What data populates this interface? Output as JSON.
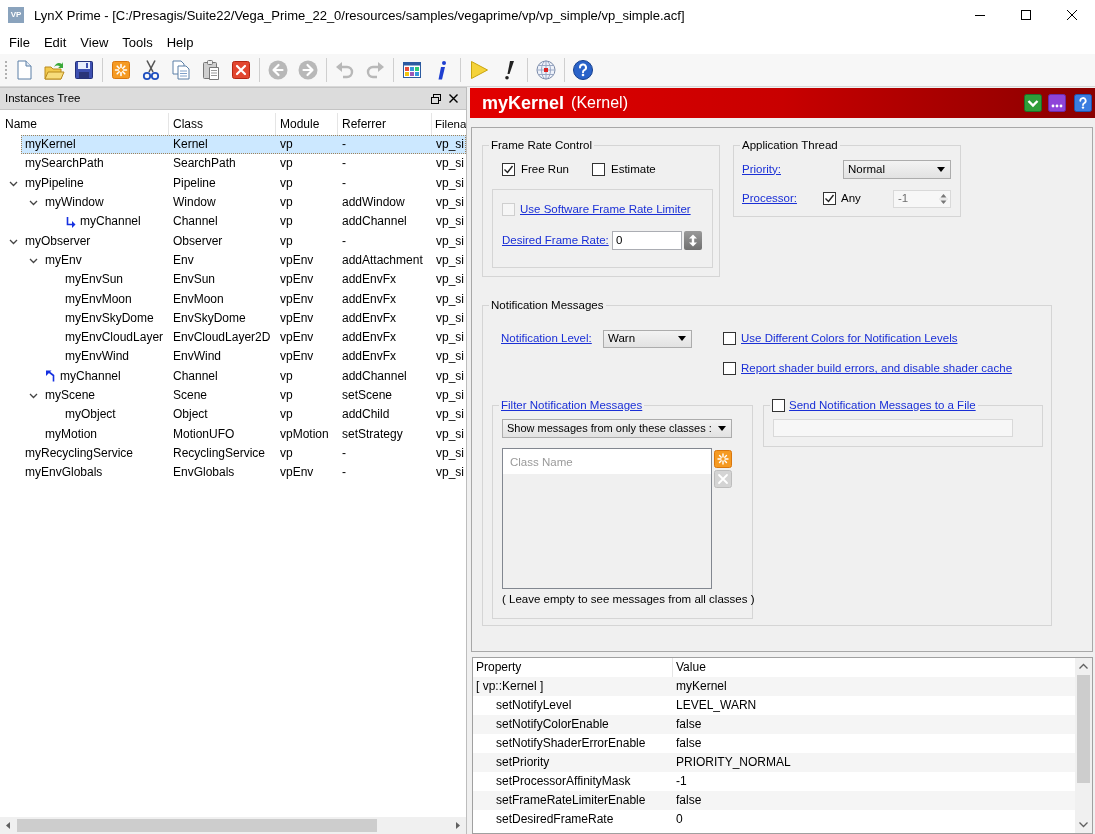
{
  "window": {
    "app_icon": "VP",
    "title": "LynX Prime - [C:/Presagis/Suite22/Vega_Prime_22_0/resources/samples/vegaprime/vp/vp_simple/vp_simple.acf]"
  },
  "menu": [
    "File",
    "Edit",
    "View",
    "Tools",
    "Help"
  ],
  "toolbar": [
    [
      {
        "kind": "new",
        "disabled": false
      },
      {
        "kind": "open",
        "disabled": false
      },
      {
        "kind": "save",
        "disabled": false
      }
    ],
    [
      {
        "kind": "create",
        "disabled": false
      },
      {
        "kind": "cut",
        "disabled": false
      },
      {
        "kind": "copy",
        "disabled": false
      },
      {
        "kind": "paste",
        "disabled": false
      },
      {
        "kind": "delete",
        "disabled": false
      }
    ],
    [
      {
        "kind": "back",
        "disabled": true
      },
      {
        "kind": "forward",
        "disabled": true
      }
    ],
    [
      {
        "kind": "undo",
        "disabled": true
      },
      {
        "kind": "redo",
        "disabled": true
      }
    ],
    [
      {
        "kind": "table",
        "disabled": false
      },
      {
        "kind": "info",
        "disabled": false
      }
    ],
    [
      {
        "kind": "run",
        "disabled": false
      },
      {
        "kind": "alert",
        "disabled": false
      }
    ],
    [
      {
        "kind": "globe",
        "disabled": false
      }
    ],
    [
      {
        "kind": "help",
        "disabled": false
      }
    ]
  ],
  "tree": {
    "title": "Instances Tree",
    "columns": [
      "Name",
      "Class",
      "Module",
      "Referrer",
      "Filena"
    ],
    "rows": [
      {
        "kind": "instance",
        "name": "myKernel",
        "class": "Kernel",
        "module": "vp",
        "referrer": "-",
        "filename": "vp_si",
        "selected": true
      },
      {
        "kind": "instance",
        "name": "mySearchPath",
        "class": "SearchPath",
        "module": "vp",
        "referrer": "-",
        "filename": "vp_si",
        "selected": false
      },
      {
        "kind": "instance",
        "name": "myPipeline",
        "class": "Pipeline",
        "module": "vp",
        "referrer": "-",
        "filename": "vp_si",
        "selected": false,
        "expanded": true,
        "children": [
          {
            "kind": "instance",
            "name": "myWindow",
            "class": "Window",
            "module": "vp",
            "referrer": "addWindow",
            "filename": "vp_si",
            "selected": false,
            "expanded": true,
            "children": [
              {
                "kind": "reference",
                "name": "myChannel",
                "class": "Channel",
                "module": "vp",
                "referrer": "addChannel",
                "filename": "vp_si",
                "selected": false
              }
            ]
          }
        ]
      },
      {
        "kind": "instance",
        "name": "myObserver",
        "class": "Observer",
        "module": "vp",
        "referrer": "-",
        "filename": "vp_si",
        "selected": false,
        "expanded": true,
        "children": [
          {
            "kind": "instance",
            "name": "myEnv",
            "class": "Env",
            "module": "vpEnv",
            "referrer": "addAttachment",
            "filename": "vp_si",
            "selected": false,
            "expanded": true,
            "children": [
              {
                "kind": "instance",
                "name": "myEnvSun",
                "class": "EnvSun",
                "module": "vpEnv",
                "referrer": "addEnvFx",
                "filename": "vp_si",
                "selected": false
              },
              {
                "kind": "instance",
                "name": "myEnvMoon",
                "class": "EnvMoon",
                "module": "vpEnv",
                "referrer": "addEnvFx",
                "filename": "vp_si",
                "selected": false
              },
              {
                "kind": "instance",
                "name": "myEnvSkyDome",
                "class": "EnvSkyDome",
                "module": "vpEnv",
                "referrer": "addEnvFx",
                "filename": "vp_si",
                "selected": false
              },
              {
                "kind": "instance",
                "name": "myEnvCloudLayer",
                "class": "EnvCloudLayer2D",
                "module": "vpEnv",
                "referrer": "addEnvFx",
                "filename": "vp_si",
                "selected": false
              },
              {
                "kind": "instance",
                "name": "myEnvWind",
                "class": "EnvWind",
                "module": "vpEnv",
                "referrer": "addEnvFx",
                "filename": "vp_si",
                "selected": false
              }
            ]
          },
          {
            "kind": "backreference",
            "name": "myChannel",
            "class": "Channel",
            "module": "vp",
            "referrer": "addChannel",
            "filename": "vp_si",
            "selected": false
          },
          {
            "kind": "instance",
            "name": "myScene",
            "class": "Scene",
            "module": "vp",
            "referrer": "setScene",
            "filename": "vp_si",
            "selected": false,
            "expanded": true,
            "children": [
              {
                "kind": "instance",
                "name": "myObject",
                "class": "Object",
                "module": "vp",
                "referrer": "addChild",
                "filename": "vp_si",
                "selected": false
              }
            ]
          },
          {
            "kind": "instance",
            "name": "myMotion",
            "class": "MotionUFO",
            "module": "vpMotion",
            "referrer": "setStrategy",
            "filename": "vp_si",
            "selected": false
          }
        ]
      },
      {
        "kind": "instance",
        "name": "myRecyclingService",
        "class": "RecyclingService",
        "module": "vp",
        "referrer": "-",
        "filename": "vp_si",
        "selected": false
      },
      {
        "kind": "instance",
        "name": "myEnvGlobals",
        "class": "EnvGlobals",
        "module": "vpEnv",
        "referrer": "-",
        "filename": "vp_si",
        "selected": false
      }
    ]
  },
  "inspector": {
    "title": "myKernel",
    "subtitle": "(Kernel)",
    "header_buttons": [
      {
        "kind": "apply"
      },
      {
        "kind": "more"
      },
      {
        "kind": "help"
      }
    ],
    "frame_rate_control": {
      "title": "Frame Rate Control",
      "free_run": {
        "label": "Free Run",
        "checked": true
      },
      "estimate": {
        "label": "Estimate",
        "checked": false
      },
      "limiter": {
        "label": "Use Software Frame Rate Limiter",
        "checked": false,
        "disabled": true
      },
      "desired_frame_rate": {
        "label": "Desired Frame Rate:",
        "value": "0"
      }
    },
    "application_thread": {
      "title": "Application Thread",
      "priority": {
        "label": "Priority:",
        "value": "Normal"
      },
      "processor": {
        "label": "Processor:",
        "any": {
          "label": "Any",
          "checked": true
        },
        "value": "-1"
      }
    },
    "notification_messages": {
      "title": "Notification Messages",
      "level": {
        "label": "Notification Level:",
        "value": "Warn"
      },
      "options": [
        {
          "label": "Use Different Colors for Notification Levels",
          "checked": false
        },
        {
          "label": "Report shader build errors, and disable shader cache",
          "checked": false
        }
      ],
      "filter": {
        "title": "Filter Notification Messages",
        "mode": "Show messages from only these classes :",
        "placeholder": "Class Name",
        "buttons": [
          {
            "kind": "add",
            "disabled": false
          },
          {
            "kind": "remove",
            "disabled": true
          }
        ],
        "note": "( Leave empty to see messages from all classes )"
      },
      "send_to_file": {
        "label": "Send Notification Messages to a File",
        "checked": false
      }
    }
  },
  "properties": {
    "columns": [
      "Property",
      "Value"
    ],
    "rows": [
      {
        "property": "[ vp::Kernel ]",
        "value": "myKernel",
        "children": [
          {
            "property": "setNotifyLevel",
            "value": "LEVEL_WARN"
          },
          {
            "property": "setNotifyColorEnable",
            "value": "false"
          },
          {
            "property": "setNotifyShaderErrorEnable",
            "value": "false"
          },
          {
            "property": "setPriority",
            "value": "PRIORITY_NORMAL"
          },
          {
            "property": "setProcessorAffinityMask",
            "value": "-1"
          },
          {
            "property": "setFrameRateLimiterEnable",
            "value": "false"
          },
          {
            "property": "setDesiredFrameRate",
            "value": "0"
          }
        ]
      }
    ]
  }
}
